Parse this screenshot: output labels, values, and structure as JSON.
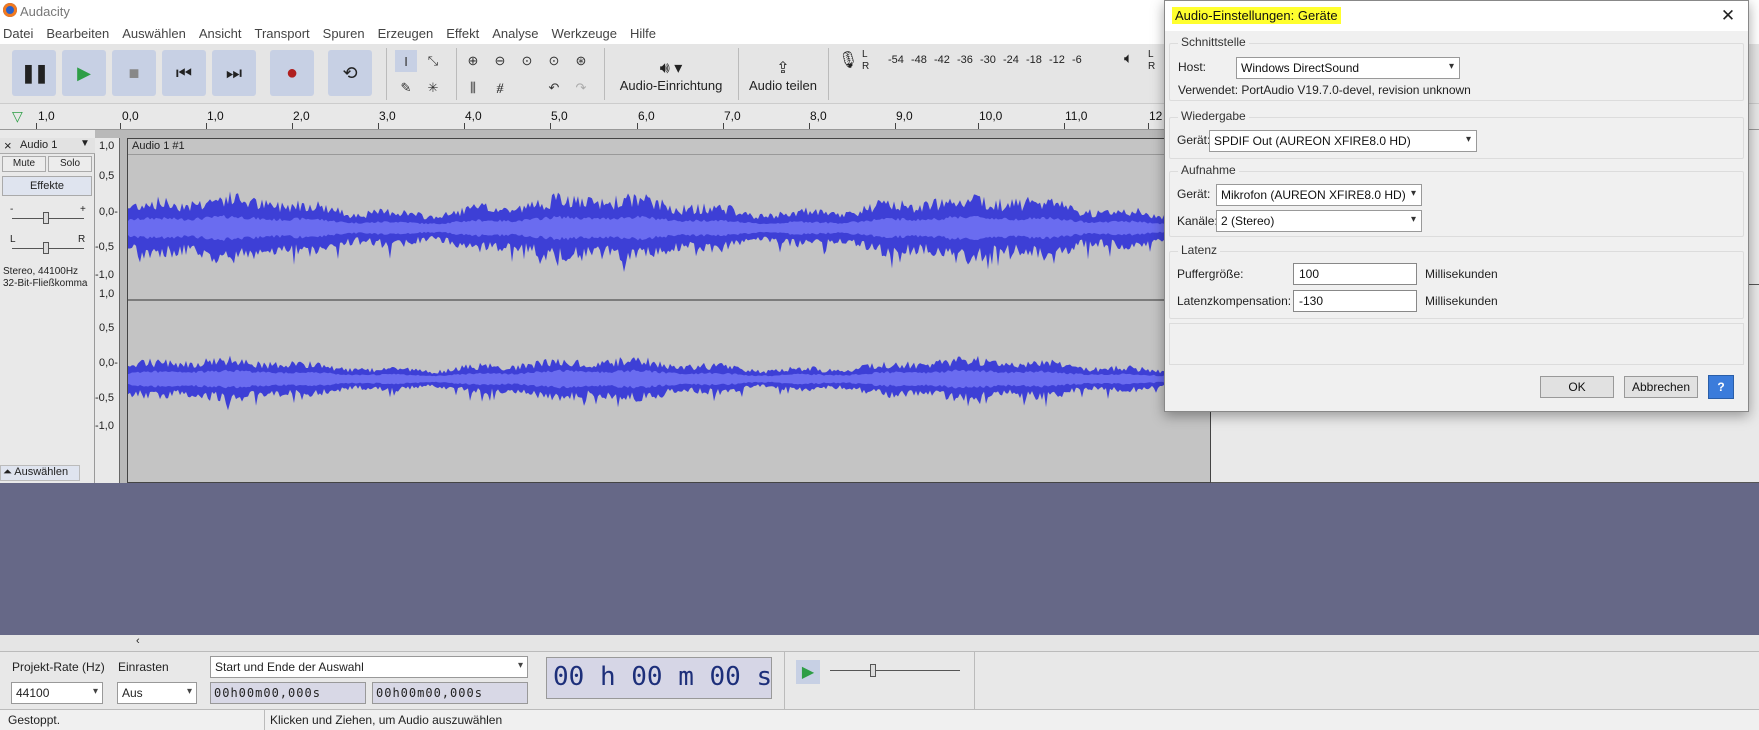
{
  "app": {
    "title": "Audacity"
  },
  "menu": [
    "Datei",
    "Bearbeiten",
    "Auswählen",
    "Ansicht",
    "Transport",
    "Spuren",
    "Erzeugen",
    "Effekt",
    "Analyse",
    "Werkzeuge",
    "Hilfe"
  ],
  "toolbar": {
    "audio_setup_label": "Audio-Einrichtung",
    "share_audio_label": "Audio teilen",
    "meter_ticks": [
      "-54",
      "-48",
      "-42",
      "-36",
      "-30",
      "-24",
      "-18",
      "-12",
      "-6"
    ],
    "meter_lr": [
      "L",
      "R"
    ]
  },
  "ruler": {
    "ticks": [
      "1,0",
      "0,0",
      "1,0",
      "2,0",
      "3,0",
      "4,0",
      "5,0",
      "6,0",
      "7,0",
      "8,0",
      "9,0",
      "10,0",
      "11,0",
      "12"
    ]
  },
  "track": {
    "name": "Audio 1",
    "clip_name": "Audio 1 #1",
    "mute_label": "Mute",
    "solo_label": "Solo",
    "effects_label": "Effekte",
    "gain_minus": "-",
    "gain_plus": "+",
    "pan_l": "L",
    "pan_r": "R",
    "info_rate": "Stereo, 44100Hz",
    "info_format": "32-Bit-Fließkomma",
    "select_label": "Auswählen",
    "scale": [
      "1,0",
      "0,5",
      "0,0-",
      "-0,5",
      "-1,0"
    ]
  },
  "selection_toolbar": {
    "project_rate_label": "Projekt-Rate (Hz)",
    "project_rate_value": "44100",
    "snap_label": "Einrasten",
    "snap_value": "Aus",
    "selection_mode": "Start und Ende der Auswahl",
    "start_time": "00h00m00,000s",
    "end_time": "00h00m00,000s",
    "big_time": "00 h 00 m 00 s"
  },
  "status": {
    "left": "Gestoppt.",
    "right": "Klicken und Ziehen, um Audio auszuwählen"
  },
  "dialog": {
    "title": "Audio-Einstellungen: Geräte",
    "interface_group": "Schnittstelle",
    "host_label": "Host:",
    "host_value": "Windows DirectSound",
    "used_label": "Verwendet: PortAudio V19.7.0-devel, revision unknown",
    "playback_group": "Wiedergabe",
    "playback_device_label": "Gerät:",
    "playback_device_value": "SPDIF Out (AUREON XFIRE8.0 HD)",
    "recording_group": "Aufnahme",
    "recording_device_label": "Gerät:",
    "recording_device_value": "Mikrofon (AUREON XFIRE8.0 HD)",
    "channels_label": "Kanäle:",
    "channels_value": "2 (Stereo)",
    "latency_group": "Latenz",
    "buffer_label": "Puffergröße:",
    "buffer_value": "100",
    "buffer_unit": "Millisekunden",
    "compensation_label": "Latenzkompensation:",
    "compensation_value": "-130",
    "compensation_unit": "Millisekunden",
    "ok_label": "OK",
    "cancel_label": "Abbrechen",
    "help_label": "?"
  },
  "colors": {
    "highlight": "#ffff2e",
    "waveform": "#3d3fd6",
    "waveform_rms": "#6a6cf0",
    "below_tracks": "#666887"
  }
}
